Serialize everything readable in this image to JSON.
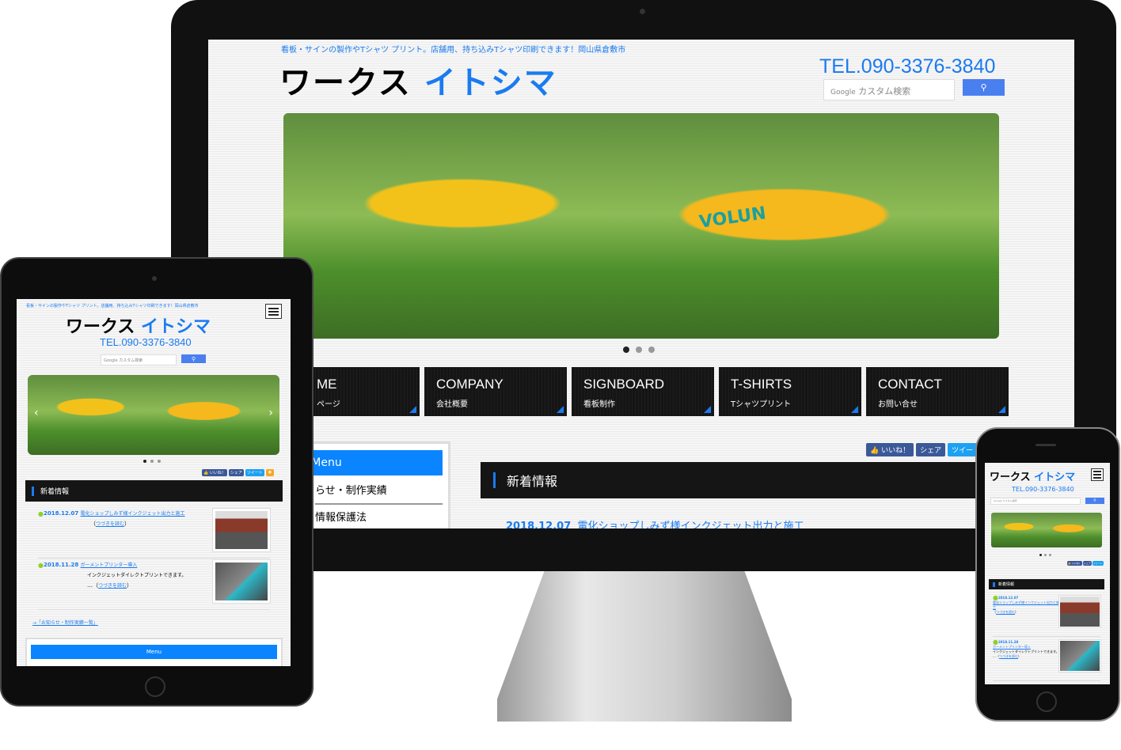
{
  "site": {
    "tagline": "看板・サインの製作やTシャツ プリント。店舗用、持ち込みTシャツ印刷できます！岡山県倉敷市",
    "logo_black": "ワークス",
    "logo_blue": "イトシマ",
    "tel": "TEL.090-3376-3840",
    "search_brand": "Google",
    "search_placeholder": "カスタム検索",
    "search_icon": "search-icon"
  },
  "nav": [
    {
      "en": "ME",
      "jp": "ページ"
    },
    {
      "en": "COMPANY",
      "jp": "会社概要"
    },
    {
      "en": "SIGNBOARD",
      "jp": "看板制作"
    },
    {
      "en": "T-SHIRTS",
      "jp": "Tシャツプリント"
    },
    {
      "en": "CONTACT",
      "jp": "お問い合せ"
    }
  ],
  "sidebar": {
    "menu": "Menu",
    "items": [
      "らせ・制作実績",
      "情報保護法"
    ]
  },
  "social": {
    "like": "👍 いいね！",
    "share": "シェア",
    "tweet": "ツイート",
    "tweet_cut": "ツイー",
    "rss": "rss-icon"
  },
  "news": {
    "heading": "新着情報",
    "items": [
      {
        "date": "2018.12.07",
        "title": "電化ショップしみず様インクジェット出力と施工",
        "title_a": "電化ショップしみず様インクジェット出力と施",
        "title_b": "工",
        "more": "つづきを読む"
      },
      {
        "date": "2018.11.28",
        "title": "ガーメントプリンター導入",
        "desc": "インクジェットダイレクトプリントできます。",
        "ellipsis": "…",
        "more": "つづきを読む"
      }
    ],
    "all_link": "→「お知らせ・制作実績一覧」"
  },
  "photo_text": "VOLUN",
  "slider_dots": 3,
  "colors": {
    "accent": "#1a7bf0",
    "nav_bg": "#151515",
    "menu": "#0a84ff",
    "bullet": "#8fd12a"
  }
}
